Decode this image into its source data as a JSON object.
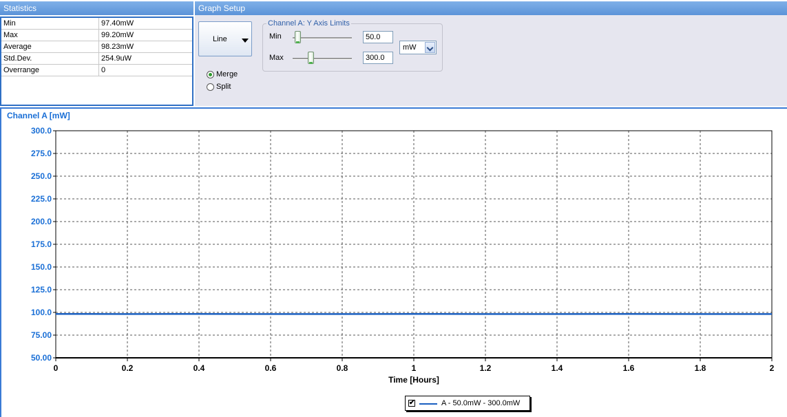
{
  "statistics": {
    "title": "Statistics",
    "rows": [
      {
        "label": "Min",
        "value": "97.40mW"
      },
      {
        "label": "Max",
        "value": "99.20mW"
      },
      {
        "label": "Average",
        "value": "98.23mW"
      },
      {
        "label": "Std.Dev.",
        "value": "254.9uW"
      },
      {
        "label": "Overrange",
        "value": "0"
      }
    ]
  },
  "graph_setup": {
    "title": "Graph Setup",
    "graph_type": "Line",
    "modes": [
      {
        "label": "Merge",
        "checked": true
      },
      {
        "label": "Split",
        "checked": false
      }
    ],
    "axis_limits": {
      "title": "Channel A: Y Axis Limits",
      "min_label": "Min",
      "min_value": "50.0",
      "max_label": "Max",
      "max_value": "300.0",
      "unit": "mW"
    }
  },
  "colors": {
    "accent": "#3a7bd5",
    "title_blue": "#1a6fd6",
    "series": "#1a5fc0"
  },
  "chart_data": {
    "type": "line",
    "title": "Channel A [mW]",
    "xlabel": "Time [Hours]",
    "ylabel": "",
    "xlim": [
      0,
      2
    ],
    "ylim": [
      50,
      300
    ],
    "x_ticks": [
      "0",
      "0.2",
      "0.4",
      "0.6",
      "0.8",
      "1",
      "1.2",
      "1.4",
      "1.6",
      "1.8",
      "2"
    ],
    "y_ticks": [
      "50.00",
      "75.00",
      "100.0",
      "125.0",
      "150.0",
      "175.0",
      "200.0",
      "225.0",
      "250.0",
      "275.0",
      "300.0"
    ],
    "grid": true,
    "legend_position": "bottom-center",
    "series": [
      {
        "name": "A - 50.0mW - 300.0mW",
        "color": "#1a5fc0",
        "x": [
          0,
          0.2,
          0.4,
          0.6,
          0.8,
          1.0,
          1.2,
          1.4,
          1.6,
          1.8,
          2.0
        ],
        "y": [
          98.3,
          98.2,
          98.3,
          98.2,
          98.2,
          98.3,
          98.2,
          98.2,
          98.3,
          98.2,
          98.2
        ]
      }
    ]
  }
}
